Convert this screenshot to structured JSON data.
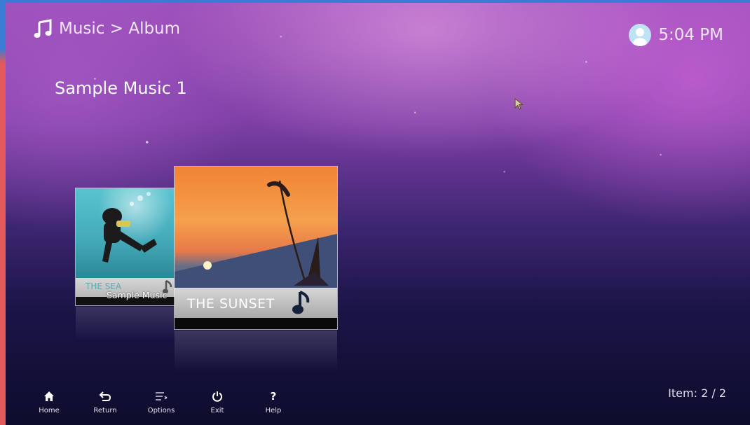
{
  "header": {
    "breadcrumb": "Music > Album",
    "breadcrumb_icon": "music-note-icon",
    "time": "5:04 PM",
    "user_icon": "user-avatar-icon"
  },
  "album": {
    "title": "Sample Music 1"
  },
  "cards": [
    {
      "title": "THE SEA",
      "subtitle": "Sample Music",
      "icon": "music-note-icon",
      "selected": false
    },
    {
      "title": "THE SUNSET",
      "icon": "music-note-icon",
      "selected": true
    }
  ],
  "footer": {
    "buttons": [
      {
        "label": "Home",
        "icon": "home-icon"
      },
      {
        "label": "Return",
        "icon": "return-icon"
      },
      {
        "label": "Options",
        "icon": "options-icon"
      },
      {
        "label": "Exit",
        "icon": "power-icon"
      },
      {
        "label": "Help",
        "icon": "help-icon"
      }
    ],
    "item_count": "Item: 2 / 2"
  },
  "colors": {
    "frame_top": "#3a7bd5",
    "frame_left": "#e25a5a",
    "background_top": "#9c4fb9",
    "background_bottom": "#0d0c2c"
  }
}
